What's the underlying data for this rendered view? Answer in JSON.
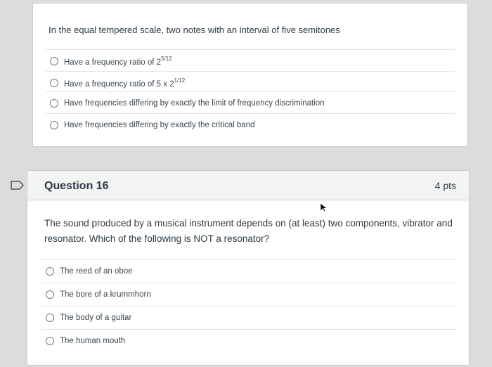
{
  "question15": {
    "prompt": "In the equal tempered scale, two notes with an interval of five semitones",
    "answers": [
      {
        "text": "Have a frequency ratio of 2",
        "sup": "5/12"
      },
      {
        "text": "Have a frequency ratio of 5 x 2",
        "sup": "1/12"
      },
      {
        "text": "Have frequencies differing by exactly the limit of frequency discrimination",
        "sup": ""
      },
      {
        "text": "Have frequencies differing by exactly the critical band",
        "sup": ""
      }
    ]
  },
  "question16": {
    "title": "Question 16",
    "points": "4 pts",
    "prompt": "The sound produced by a musical instrument depends on (at least) two components, vibrator and resonator. Which of the following is NOT a resonator?",
    "answers": [
      {
        "text": "The reed of an oboe"
      },
      {
        "text": "The bore of a krummhorn"
      },
      {
        "text": "The body of a guitar"
      },
      {
        "text": "The human mouth"
      }
    ]
  },
  "colors": {
    "text": "#2d3b45",
    "border": "#c7cdd1",
    "header_bg": "#f3f4f4",
    "page_bg": "#dcdcdb"
  },
  "icons": {
    "flag": "flag-outline-icon",
    "cursor": "mouse-pointer-icon",
    "radio": "radio-button-icon"
  }
}
